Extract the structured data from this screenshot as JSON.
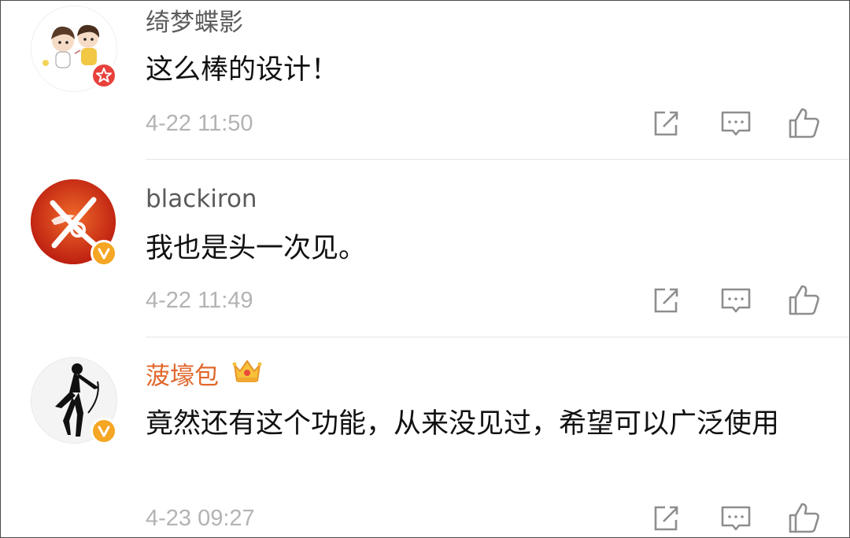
{
  "comments": [
    {
      "username": "绮梦蝶影",
      "content": "这么棒的设计！",
      "time": "4-22 11:50",
      "badge": "red-star-badge",
      "name_color": "#5b5b5b"
    },
    {
      "username": "blackiron",
      "content": "我也是头一次见。",
      "time": "4-22 11:49",
      "badge": "yellow-v-badge",
      "name_color": "#5b5b5b"
    },
    {
      "username": "菠壕包",
      "content": "竟然还有这个功能，从来没见过，希望可以广泛使用",
      "time": "4-23 09:27",
      "badge": "yellow-v-badge",
      "name_icon": "crown-icon",
      "name_color": "#e0682c"
    }
  ],
  "actions": {
    "share_icon": "share-icon",
    "reply_icon": "reply-icon",
    "like_icon": "thumbs-up-icon"
  },
  "colors": {
    "time": "#b3b3b3",
    "vip_name": "#e0682c",
    "icon": "#8e8e8e",
    "badge_red": "#e8413c",
    "badge_yellow": "#f5a623"
  }
}
